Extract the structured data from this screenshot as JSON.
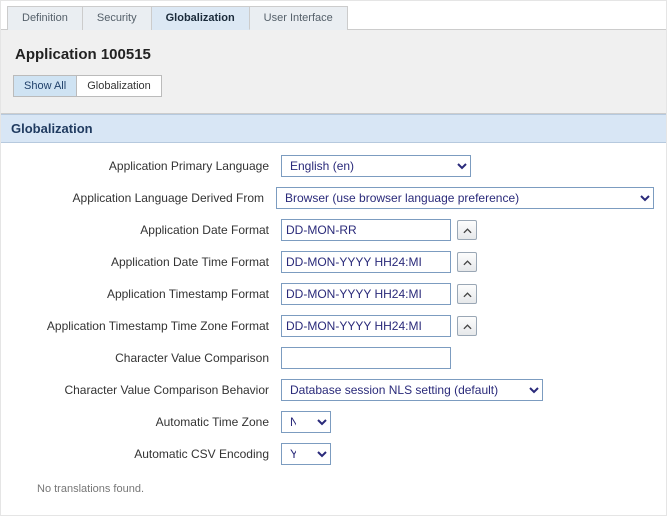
{
  "tabs": {
    "definition": "Definition",
    "security": "Security",
    "globalization": "Globalization",
    "user_interface": "User Interface"
  },
  "header": {
    "title": "Application 100515",
    "subtabs": {
      "show_all": "Show All",
      "globalization": "Globalization"
    }
  },
  "section": {
    "title": "Globalization"
  },
  "form": {
    "primary_language": {
      "label": "Application Primary Language",
      "value": "English (en)"
    },
    "language_derived": {
      "label": "Application Language Derived From",
      "value": "Browser (use browser language preference)"
    },
    "date_format": {
      "label": "Application Date Format",
      "value": "DD-MON-RR"
    },
    "datetime_format": {
      "label": "Application Date Time Format",
      "value": "DD-MON-YYYY HH24:MI"
    },
    "timestamp_format": {
      "label": "Application Timestamp Format",
      "value": "DD-MON-YYYY HH24:MI"
    },
    "timestamp_tz_format": {
      "label": "Application Timestamp Time Zone Format",
      "value": "DD-MON-YYYY HH24:MI"
    },
    "char_value_comparison": {
      "label": "Character Value Comparison",
      "value": ""
    },
    "char_value_comparison_behavior": {
      "label": "Character Value Comparison Behavior",
      "value": "Database session NLS setting (default)"
    },
    "auto_timezone": {
      "label": "Automatic Time Zone",
      "value": "No"
    },
    "auto_csv": {
      "label": "Automatic CSV Encoding",
      "value": "Yes"
    }
  },
  "footer": {
    "no_translations": "No translations found."
  }
}
